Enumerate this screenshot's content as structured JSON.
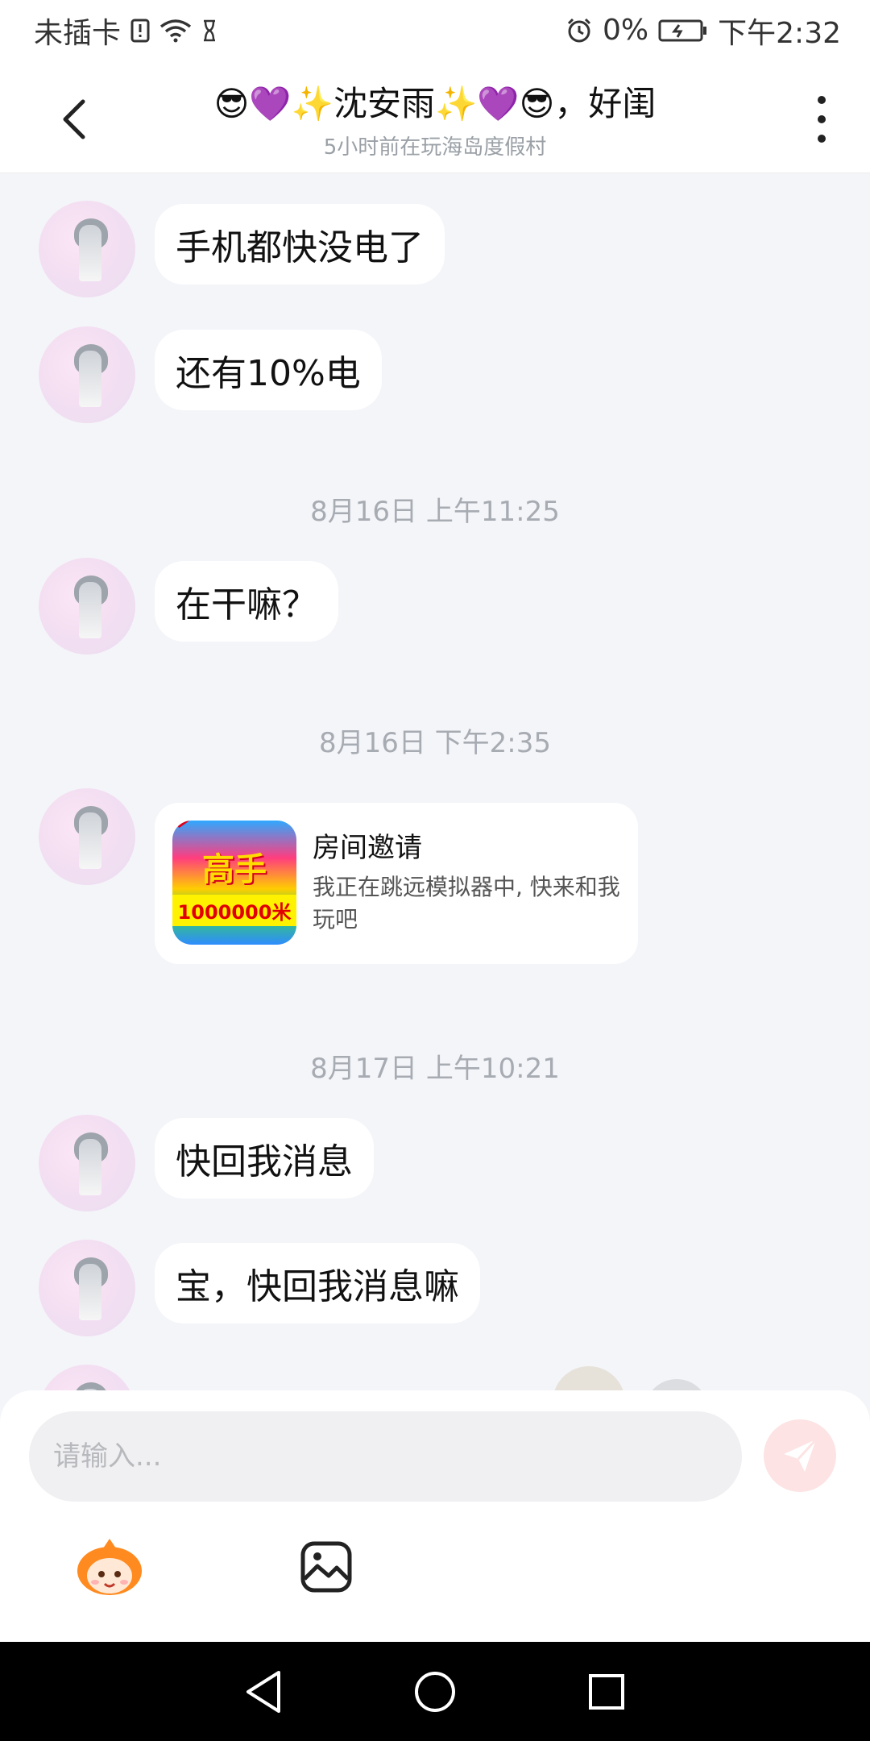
{
  "status_bar": {
    "carrier": "未插卡",
    "battery_percent": "0%",
    "time": "下午2:32",
    "icons": [
      "sim-alert-icon",
      "wifi-icon",
      "hourglass-icon",
      "alarm-icon",
      "battery-charging-icon"
    ]
  },
  "header": {
    "title": "😎💜✨沈安雨✨💜😎，好闺",
    "subtitle": "5小时前在玩海岛度假村"
  },
  "messages": [
    {
      "type": "text",
      "text": "手机都快没电了"
    },
    {
      "type": "text",
      "text": "还有10%电"
    },
    {
      "type": "time",
      "text": "8月16日 上午11:25"
    },
    {
      "type": "text",
      "text": "在干嘛？"
    },
    {
      "type": "time",
      "text": "8月16日 下午2:35"
    },
    {
      "type": "invite",
      "title": "房间邀请",
      "desc": "我正在跳远模拟器中, 快来和我玩吧",
      "thumb_text_1": "高手",
      "thumb_text_2": "1000000米"
    },
    {
      "type": "time",
      "text": "8月17日 上午10:21"
    },
    {
      "type": "text",
      "text": "快回我消息"
    },
    {
      "type": "text",
      "text": "宝，快回我消息嘛"
    }
  ],
  "composer": {
    "placeholder": "请输入...",
    "send_color": "#fde3e3",
    "tools": [
      "mascot-emoji-icon",
      "image-icon"
    ]
  },
  "navbar": {
    "icons": [
      "back-triangle-icon",
      "home-circle-icon",
      "recents-square-icon"
    ]
  }
}
